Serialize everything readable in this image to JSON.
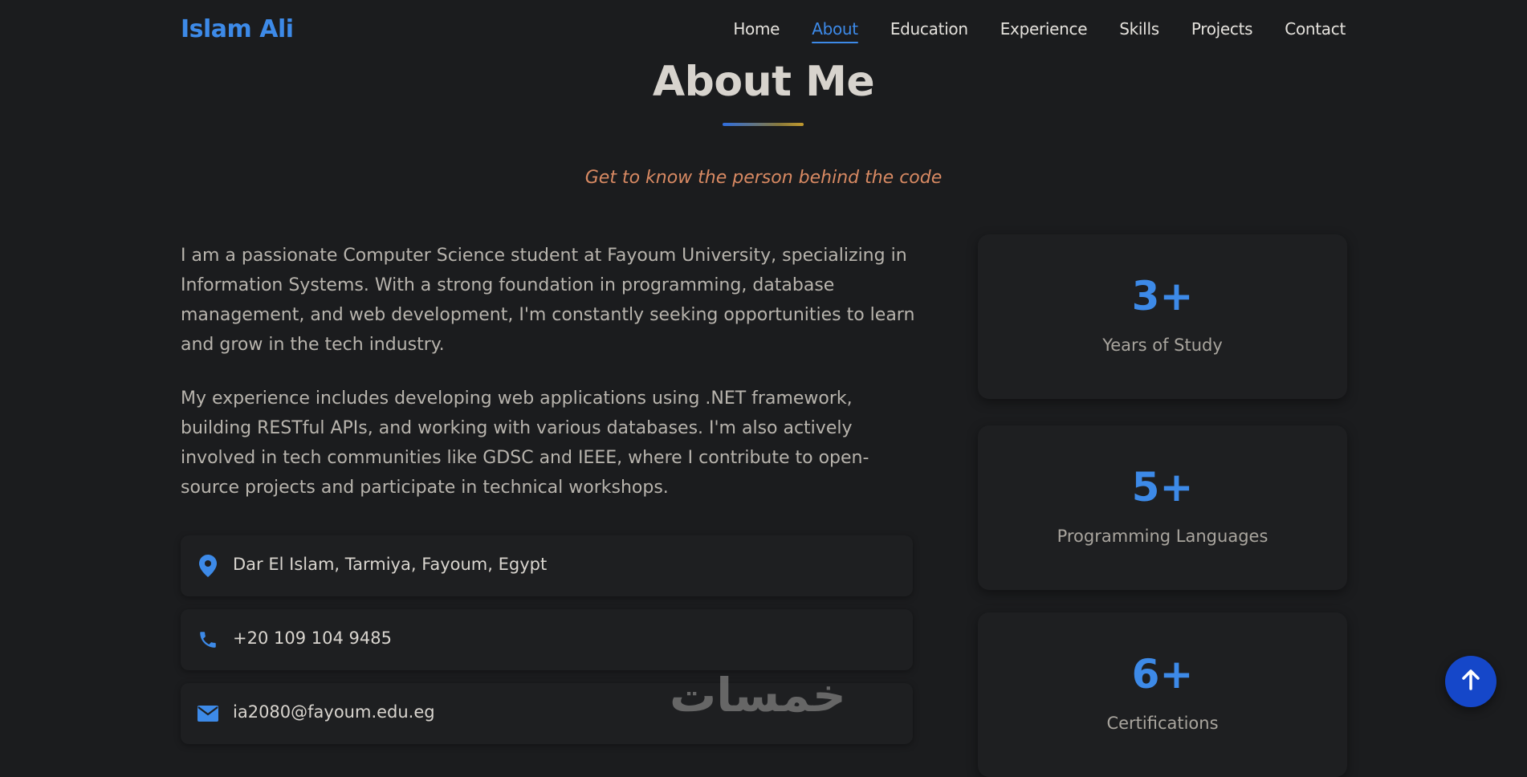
{
  "brand": "Islam Ali",
  "nav": {
    "items": [
      {
        "label": "Home"
      },
      {
        "label": "About",
        "active": true
      },
      {
        "label": "Education"
      },
      {
        "label": "Experience"
      },
      {
        "label": "Skills"
      },
      {
        "label": "Projects"
      },
      {
        "label": "Contact"
      }
    ]
  },
  "about": {
    "title": "About Me",
    "subtitle": "Get to know the person behind the code",
    "paragraphs": [
      "I am a passionate Computer Science student at Fayoum University, specializing in Information Systems. With a strong foundation in programming, database management, and web development, I'm constantly seeking opportunities to learn and grow in the tech industry.",
      "My experience includes developing web applications using .NET framework, building RESTful APIs, and working with various databases. I'm also actively involved in tech communities like GDSC and IEEE, where I contribute to open-source projects and participate in technical workshops."
    ],
    "contacts": [
      {
        "icon": "map-pin-icon",
        "text": "Dar El Islam, Tarmiya, Fayoum, Egypt"
      },
      {
        "icon": "phone-icon",
        "text": "+20 109 104 9485"
      },
      {
        "icon": "envelope-icon",
        "text": "ia2080@fayoum.edu.eg"
      }
    ],
    "stats": [
      {
        "value": "3+",
        "label": "Years of Study"
      },
      {
        "value": "5+",
        "label": "Programming Languages"
      },
      {
        "value": "6+",
        "label": "Certifications"
      }
    ]
  },
  "watermark": "خمسات",
  "colors": {
    "accent": "#3d8ae8",
    "subtitle": "#d98a63",
    "background": "#1b1c1e",
    "scroll_button": "#1547c9"
  }
}
